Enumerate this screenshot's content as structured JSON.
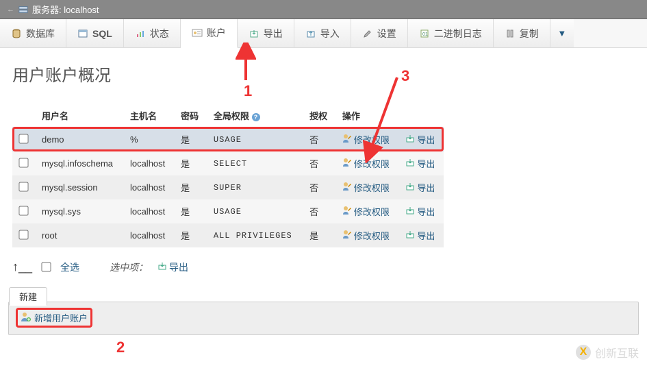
{
  "titlebar": {
    "label": "服务器: localhost"
  },
  "nav": {
    "database": "数据库",
    "sql": "SQL",
    "status": "状态",
    "accounts": "账户",
    "export": "导出",
    "import": "导入",
    "settings": "设置",
    "binlog": "二进制日志",
    "replication": "复制"
  },
  "page": {
    "title": "用户账户概况"
  },
  "headers": {
    "user": "用户名",
    "host": "主机名",
    "pwd": "密码",
    "global": "全局权限",
    "grant": "授权",
    "ops": "操作"
  },
  "ops": {
    "edit": "修改权限",
    "export": "导出"
  },
  "rows": [
    {
      "user": "demo",
      "host": "%",
      "pwd": "是",
      "global": "USAGE",
      "grant": "否"
    },
    {
      "user": "mysql.infoschema",
      "host": "localhost",
      "pwd": "是",
      "global": "SELECT",
      "grant": "否"
    },
    {
      "user": "mysql.session",
      "host": "localhost",
      "pwd": "是",
      "global": "SUPER",
      "grant": "否"
    },
    {
      "user": "mysql.sys",
      "host": "localhost",
      "pwd": "是",
      "global": "USAGE",
      "grant": "否"
    },
    {
      "user": "root",
      "host": "localhost",
      "pwd": "是",
      "global": "ALL PRIVILEGES",
      "grant": "是"
    }
  ],
  "below": {
    "checkall": "全选",
    "selected": "选中项：",
    "export": "导出"
  },
  "newsec": {
    "tab": "新建",
    "link": "新增用户账户"
  },
  "annots": {
    "one": "1",
    "two": "2",
    "three": "3"
  },
  "watermark": {
    "text": "创新互联",
    "logo": "X"
  }
}
